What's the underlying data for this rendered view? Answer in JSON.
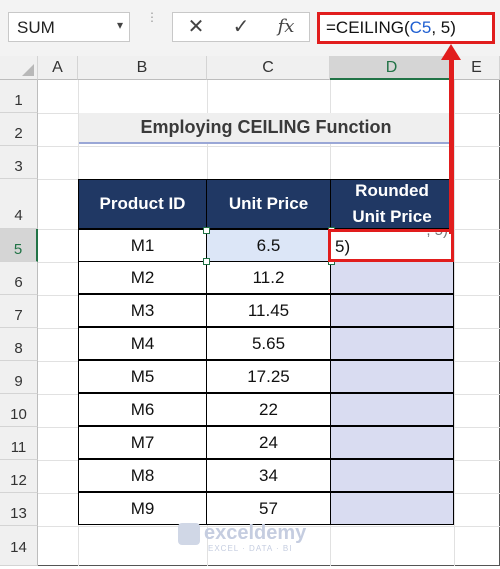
{
  "formula_bar": {
    "name_box": "SUM",
    "cancel_icon": "✕",
    "enter_icon": "✓",
    "fx_label": "fx",
    "formula_prefix": "=CEILING(",
    "formula_ref": "C5",
    "formula_suffix": ", 5)"
  },
  "columns": [
    "A",
    "B",
    "C",
    "D",
    "E"
  ],
  "rows": [
    "1",
    "2",
    "3",
    "4",
    "5",
    "6",
    "7",
    "8",
    "9",
    "10",
    "11",
    "12",
    "13",
    "14"
  ],
  "title": "Employing CEILING Function",
  "table": {
    "headers": [
      "Product ID",
      "Unit Price",
      "Rounded Unit Price"
    ],
    "rows": [
      {
        "id": "M1",
        "price": "6.5"
      },
      {
        "id": "M2",
        "price": "11.2"
      },
      {
        "id": "M3",
        "price": "11.45"
      },
      {
        "id": "M4",
        "price": "5.65"
      },
      {
        "id": "M5",
        "price": "17.25"
      },
      {
        "id": "M6",
        "price": "22"
      },
      {
        "id": "M7",
        "price": "24"
      },
      {
        "id": "M8",
        "price": "34"
      },
      {
        "id": "M9",
        "price": "57"
      }
    ]
  },
  "edit_cell": {
    "visible_text": "5)",
    "overflow_text": ", 5)"
  },
  "watermark": {
    "name": "exceldemy",
    "tagline": "EXCEL · DATA · BI"
  },
  "colors": {
    "header_fill": "#203864",
    "rounded_fill": "#d9dcf1",
    "highlight_red": "#e11d1d",
    "excel_green": "#217346"
  }
}
